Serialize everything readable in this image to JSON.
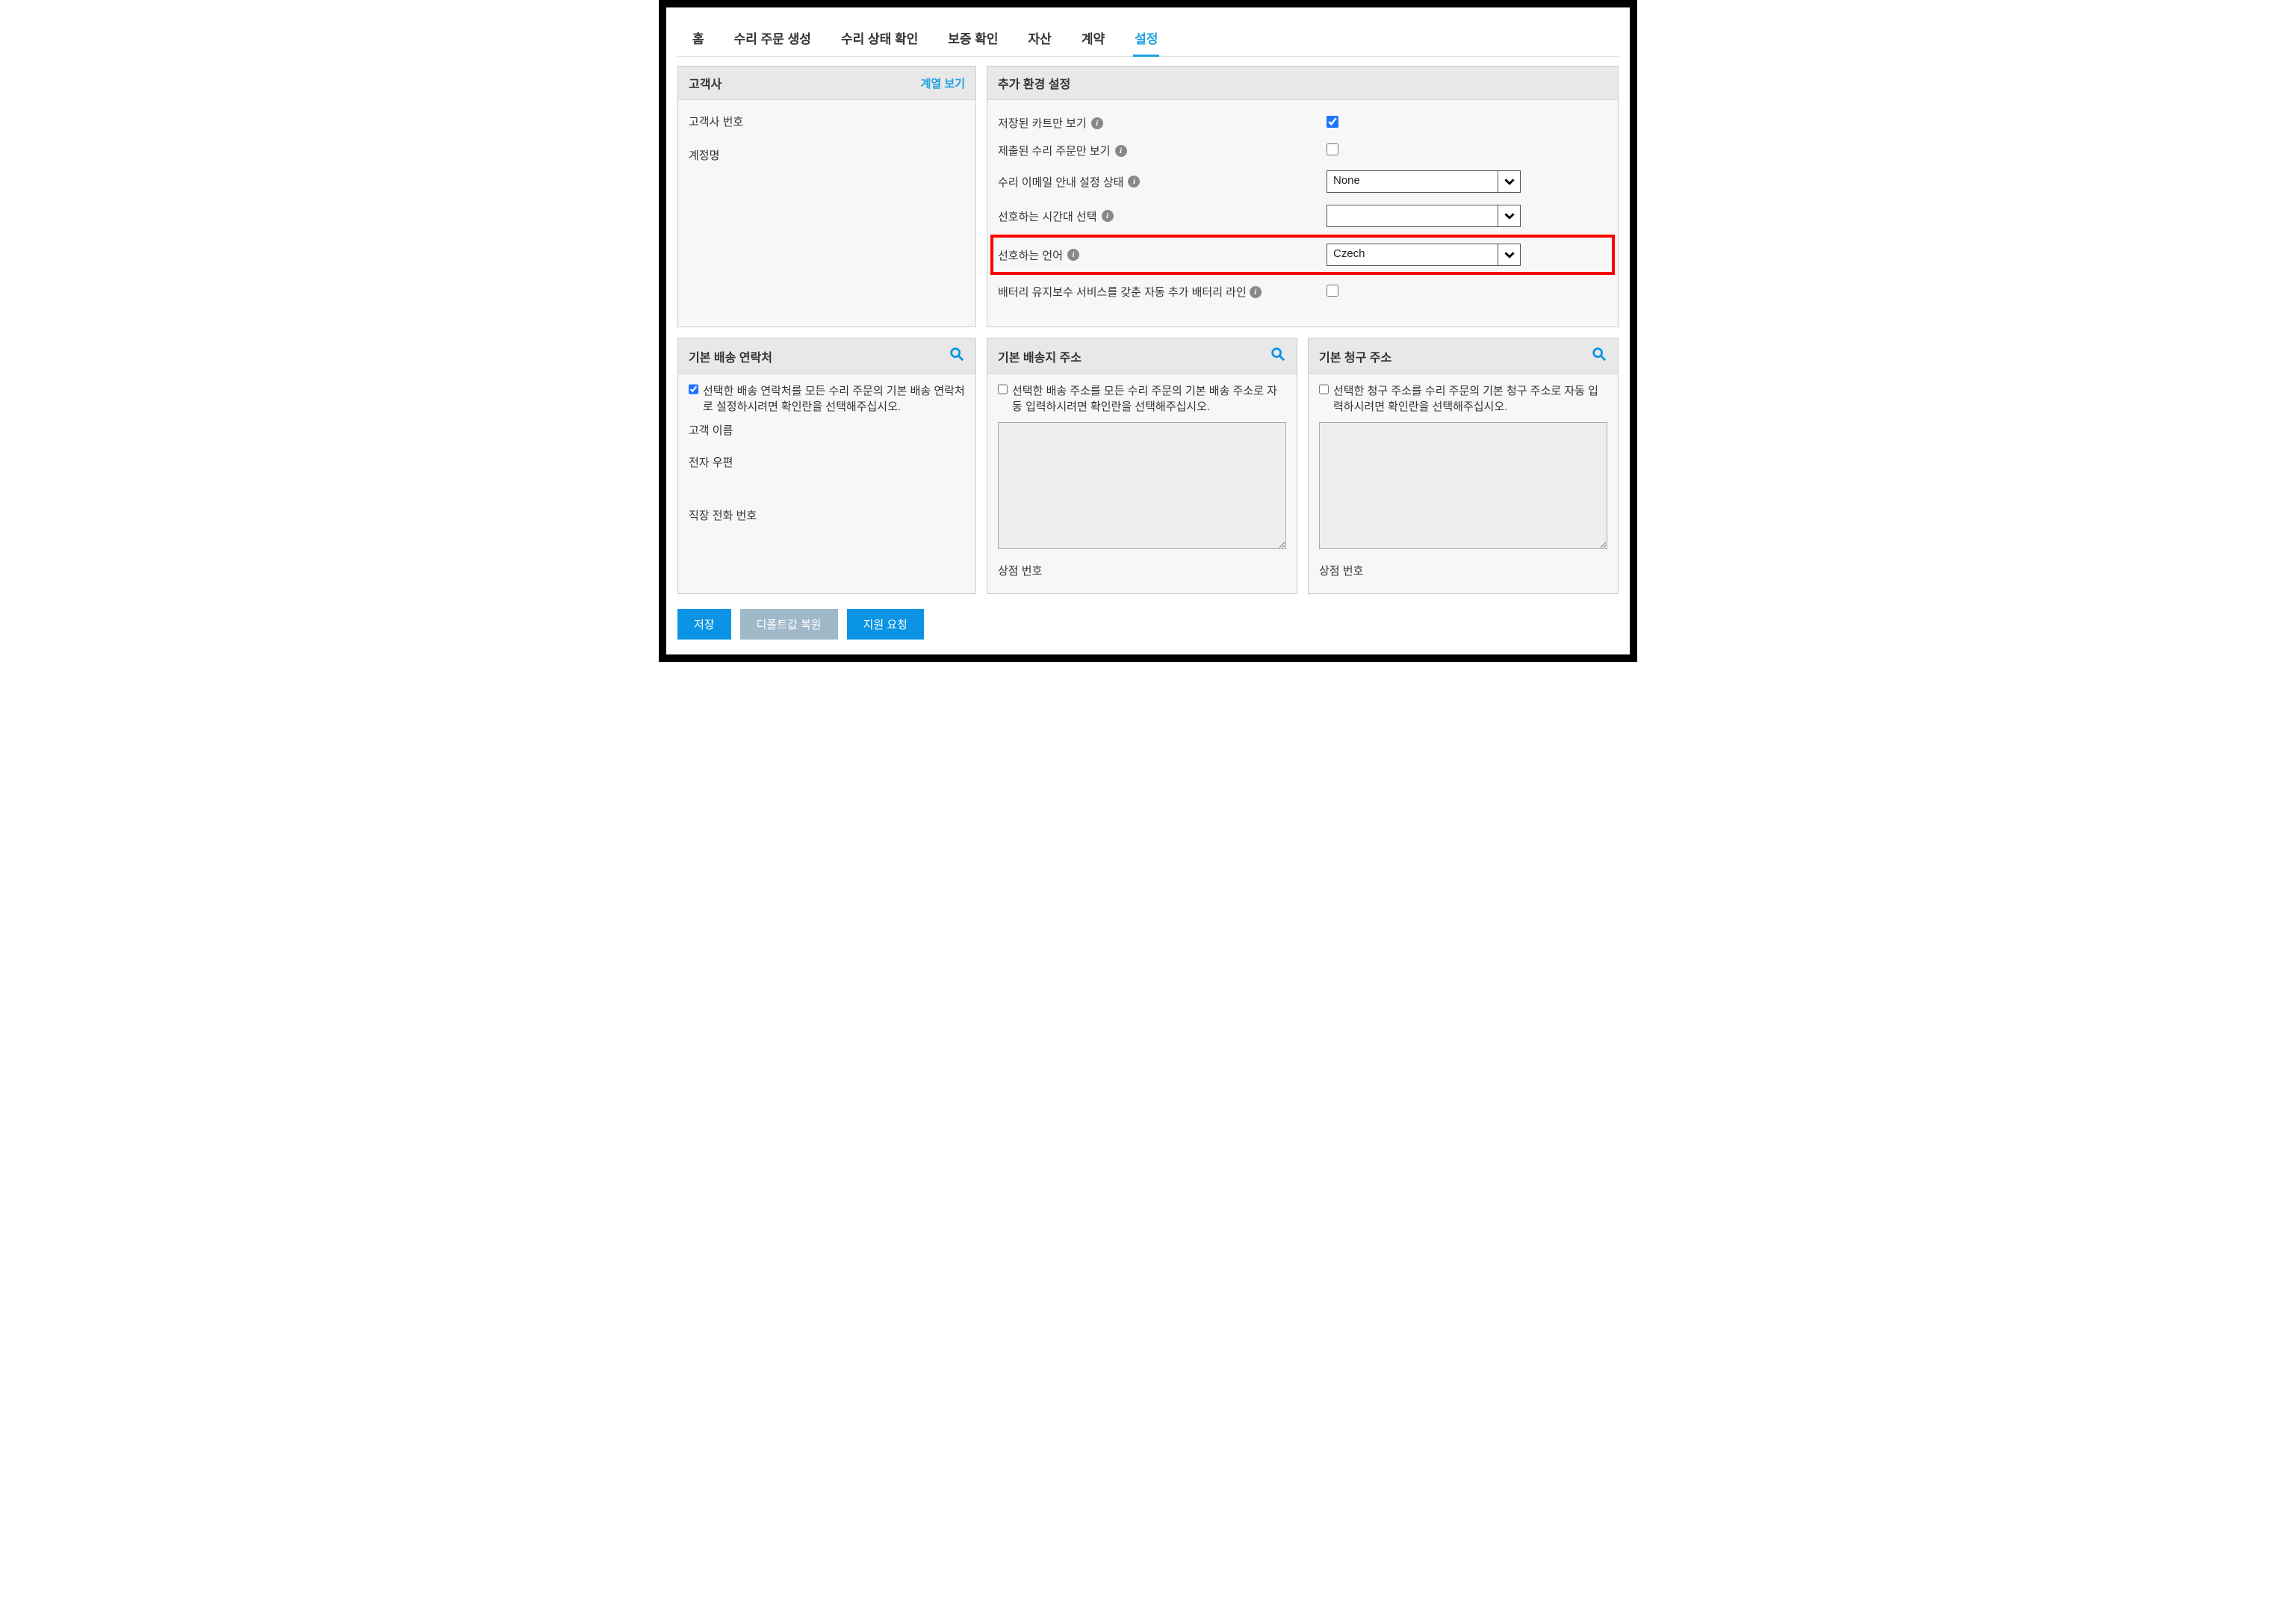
{
  "tabs": {
    "items": [
      {
        "label": "홈"
      },
      {
        "label": "수리 주문 생성"
      },
      {
        "label": "수리 상태 확인"
      },
      {
        "label": "보증 확인"
      },
      {
        "label": "자산"
      },
      {
        "label": "계약"
      },
      {
        "label": "설정"
      }
    ],
    "active_index": 6
  },
  "customer_panel": {
    "title": "고객사",
    "link": "계열 보기",
    "customer_number_label": "고객사 번호",
    "account_name_label": "계정명"
  },
  "prefs_panel": {
    "title": "추가 환경 설정",
    "saved_cart_only_label": "저장된 카트만 보기",
    "saved_cart_only_checked": true,
    "submitted_repair_only_label": "제출된 수리 주문만 보기",
    "submitted_repair_only_checked": false,
    "repair_email_label": "수리 이메일 안내 설정 상태",
    "repair_email_value": "None",
    "timezone_label": "선호하는 시간대 선택",
    "timezone_value": "",
    "language_label": "선호하는 언어",
    "language_value": "Czech",
    "battery_label": "배터리 유지보수 서비스를 갖춘 자동 추가 배터리 라인",
    "battery_checked": false
  },
  "contact_panel": {
    "title": "기본 배송 연락처",
    "checkbox_label": "선택한 배송 연락처를 모든 수리 주문의 기본 배송 연락처로 설정하시려면 확인란을 선택해주십시오.",
    "checked": true,
    "customer_name_label": "고객 이름",
    "email_label": "전자 우편",
    "work_phone_label": "직장 전화 번호"
  },
  "ship_panel": {
    "title": "기본 배송지 주소",
    "checkbox_label": "선택한 배송 주소를 모든 수리 주문의 기본 배송 주소로 자동 입력하시려면 확인란을 선택해주십시오.",
    "checked": false,
    "store_number_label": "상점 번호",
    "address_value": ""
  },
  "bill_panel": {
    "title": "기본 청구 주소",
    "checkbox_label": "선택한 청구 주소를 수리 주문의 기본 청구 주소로 자동 입력하시려면 확인란을 선택해주십시오.",
    "checked": false,
    "store_number_label": "상점 번호",
    "address_value": ""
  },
  "buttons": {
    "save": "저장",
    "restore": "디폴트값 복원",
    "request": "지원 요청"
  },
  "colors": {
    "accent": "#1ba1e2",
    "highlight": "#ff0000"
  }
}
